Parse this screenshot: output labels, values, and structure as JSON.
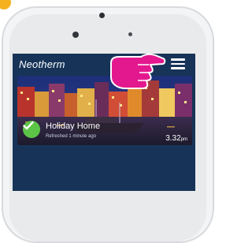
{
  "app": {
    "brand": "Neotherm"
  },
  "zone": {
    "name": "Holiday Home",
    "updated": "Refreshed 1 minute ago",
    "time": "3.32",
    "time_suffix": "pm"
  },
  "colors": {
    "screen_bg": "#173458",
    "status_ok": "#5cc447",
    "badge": "#f5b21f",
    "pointer_hand": "#e4188e"
  },
  "icons": {
    "menu": "hamburger-menu-icon",
    "status": "checkmark-icon",
    "pointer": "pointing-hand-icon"
  }
}
